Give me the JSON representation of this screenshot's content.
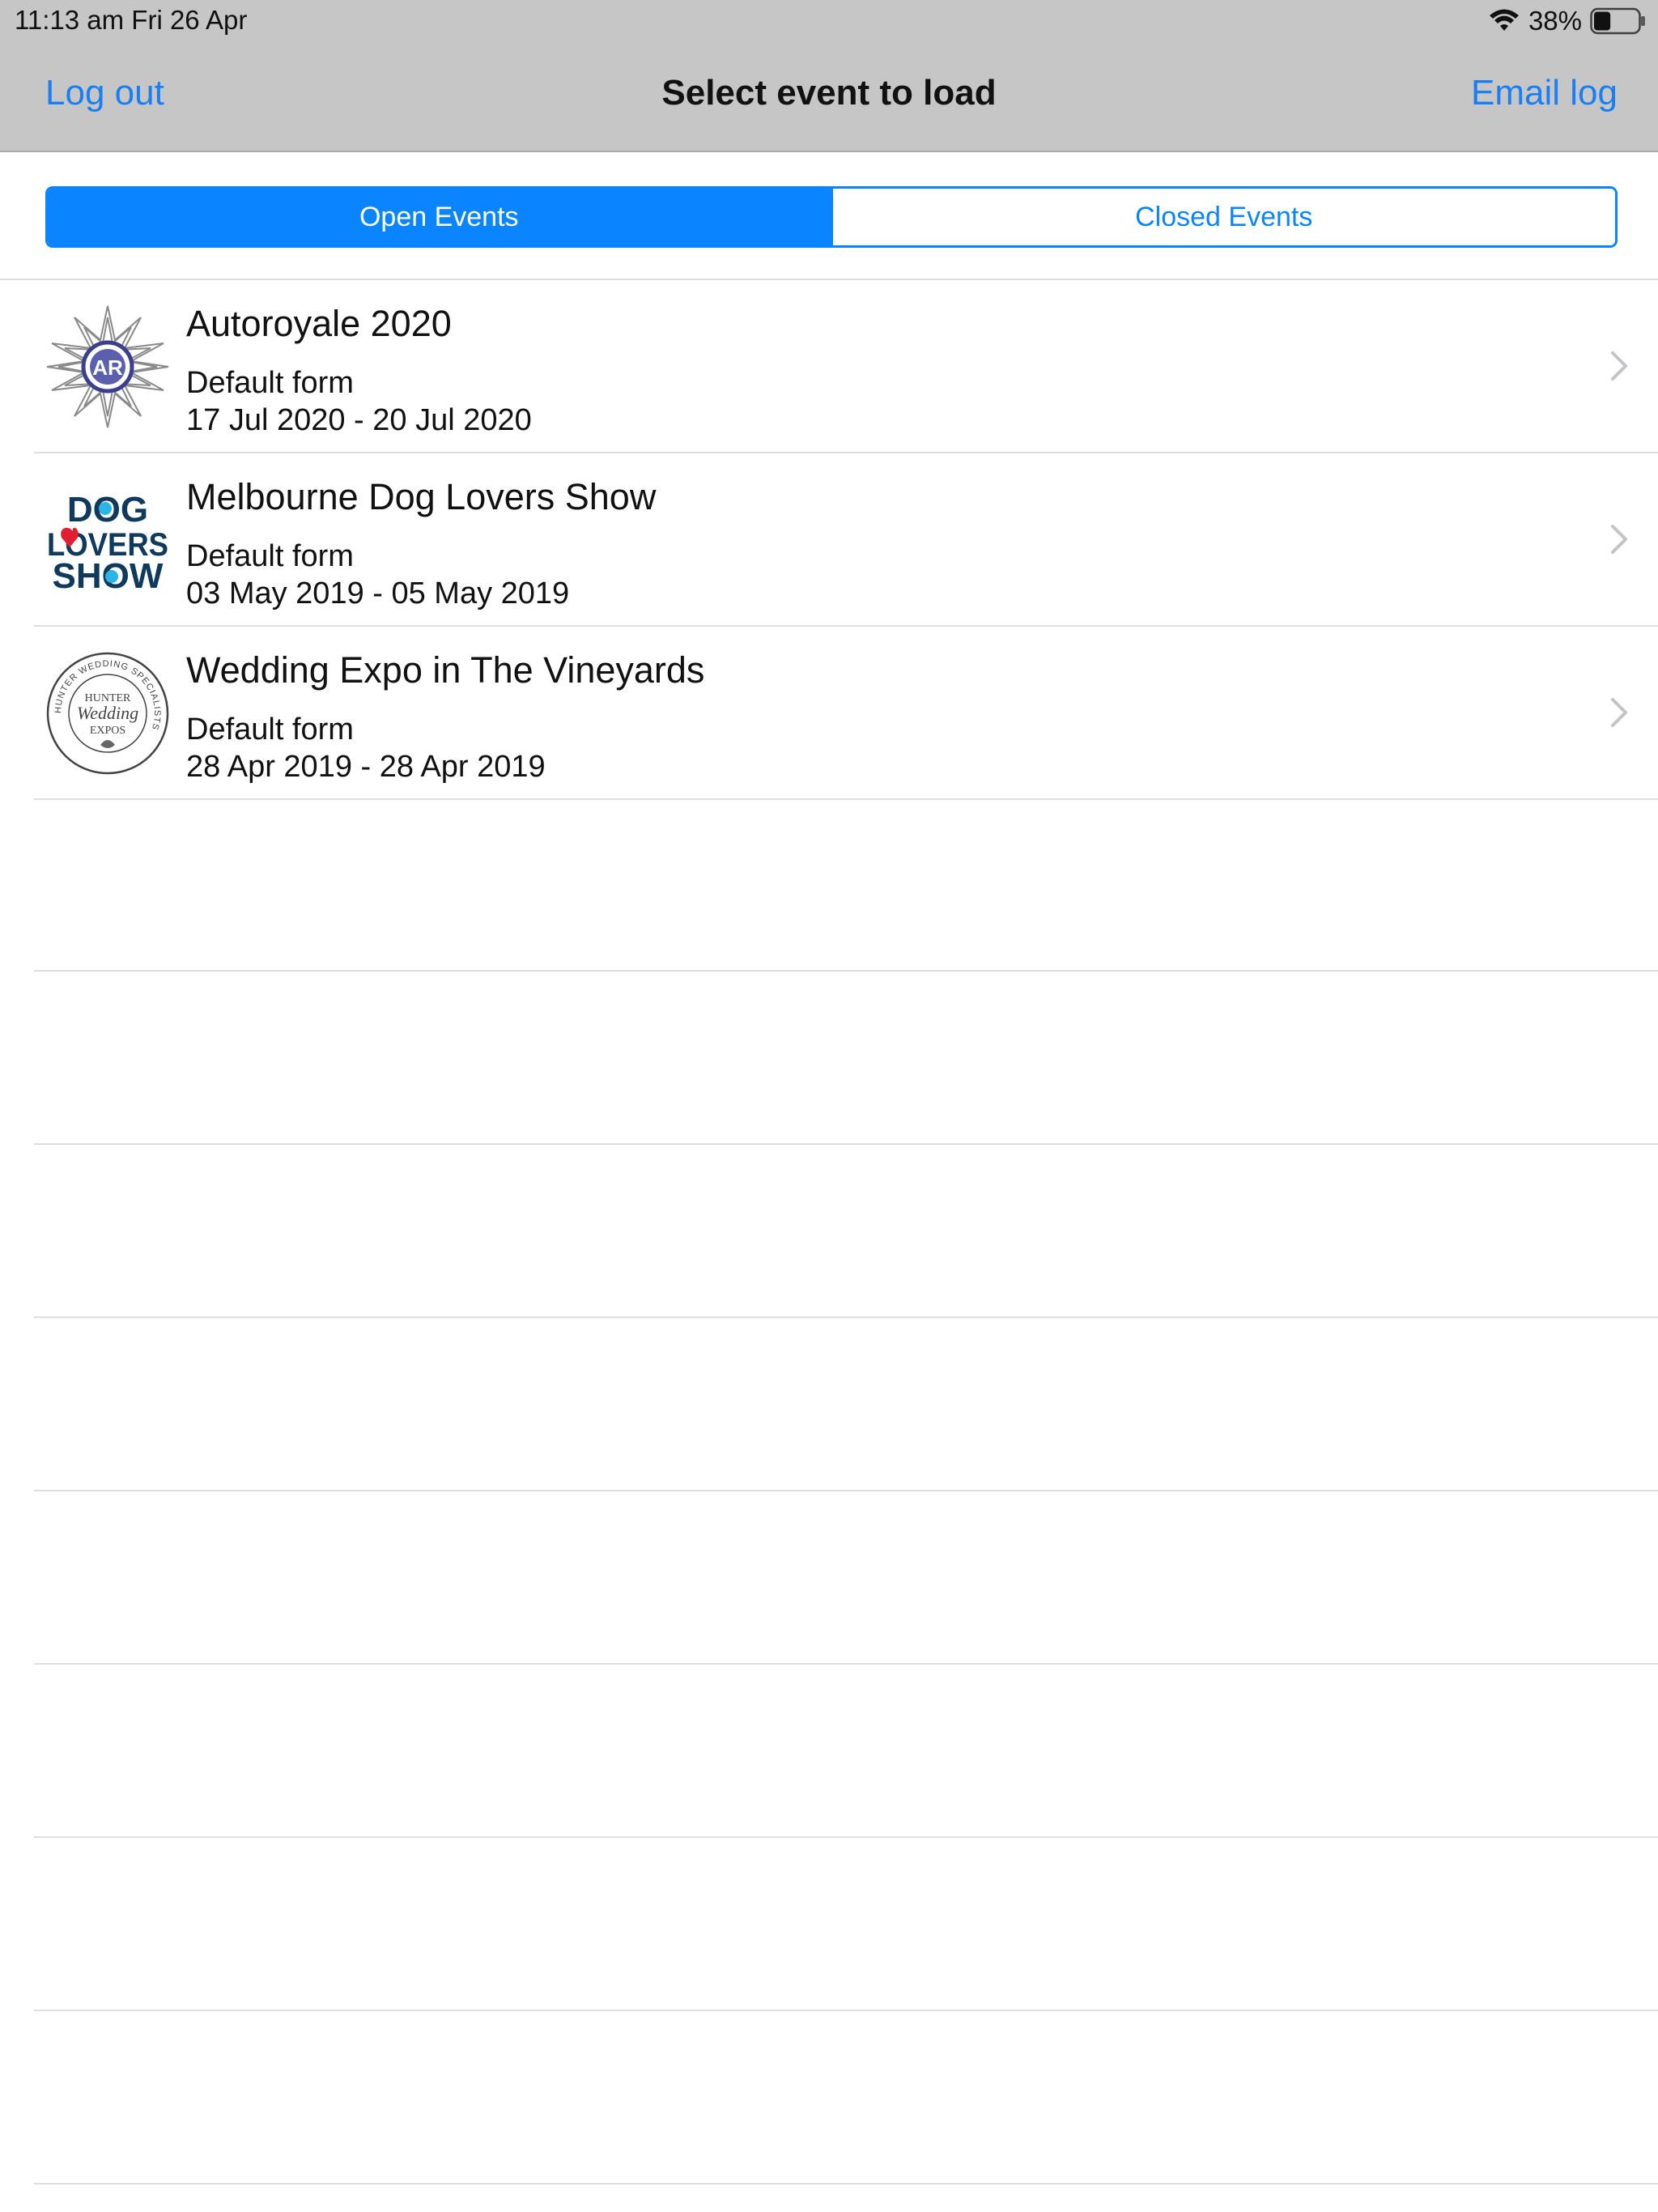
{
  "status_bar": {
    "time_date": "11:13 am   Fri 26 Apr",
    "battery_percent": "38%",
    "battery_level": 0.38
  },
  "nav": {
    "left_label": "Log out",
    "title": "Select event to load",
    "right_label": "Email log"
  },
  "segments": {
    "open_label": "Open Events",
    "closed_label": "Closed Events",
    "selected": "Open Events"
  },
  "events": [
    {
      "title": "Autoroyale 2020",
      "form": "Default form",
      "dates": "17 Jul 2020 - 20 Jul 2020",
      "logo_icon": "autoroyale-logo-icon"
    },
    {
      "title": "Melbourne Dog Lovers Show",
      "form": "Default form",
      "dates": "03 May 2019 - 05 May 2019",
      "logo_icon": "dog-lovers-show-logo-icon",
      "logo_text": [
        "DOG",
        "LOVERS",
        "SHOW"
      ]
    },
    {
      "title": "Wedding Expo in The Vineyards",
      "form": "Default form",
      "dates": "28 Apr 2019 - 28 Apr 2019",
      "logo_icon": "hunter-wedding-expos-logo-icon",
      "logo_text": [
        "HUNTER WEDDING SPECIALISTS",
        "HUNTER",
        "Wedding",
        "EXPOS"
      ]
    }
  ],
  "colors": {
    "accent": "#0a84ff",
    "nav_bar": "#c6c6c6",
    "separator": "#dedede"
  }
}
